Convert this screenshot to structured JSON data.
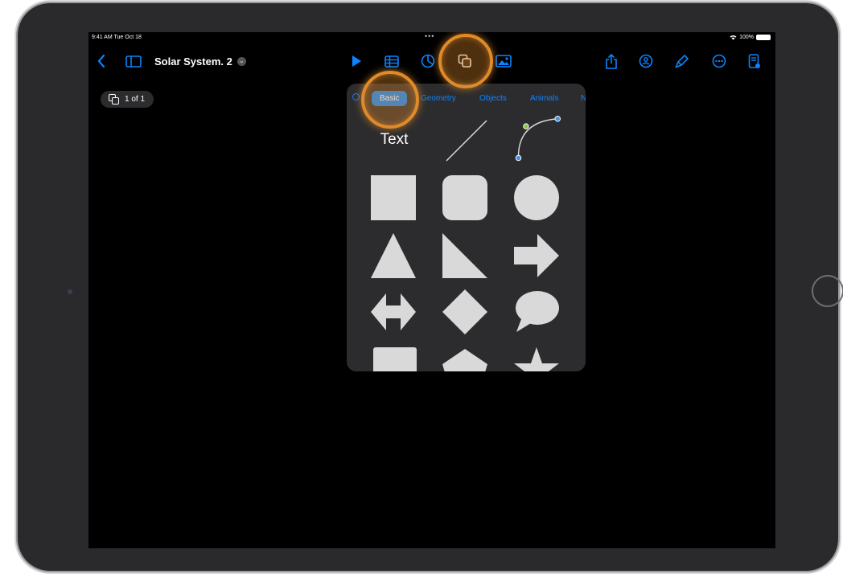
{
  "status_bar": {
    "time": "9:41 AM  Tue Oct 18",
    "dots": "•••",
    "battery": "100%"
  },
  "toolbar": {
    "back_icon": "chevron-left-icon",
    "sidebar_icon": "sidebar-icon",
    "document_title": "Solar System. 2",
    "center_icons": [
      "play-icon",
      "table-icon",
      "chart-icon",
      "shapes-icon",
      "media-icon"
    ],
    "right_icons": [
      "share-icon",
      "collaborate-icon",
      "format-brush-icon",
      "more-icon",
      "document-setup-icon"
    ]
  },
  "page_counter": {
    "label": "1 of 1"
  },
  "shapes_popover": {
    "tabs": [
      {
        "label": "Basic",
        "active": true
      },
      {
        "label": "Geometry",
        "active": false
      },
      {
        "label": "Objects",
        "active": false
      },
      {
        "label": "Animals",
        "active": false
      },
      {
        "label": "N",
        "active": false
      }
    ],
    "text_shape_label": "Text",
    "shapes": [
      "text",
      "line",
      "curve",
      "square",
      "rounded-square",
      "circle",
      "triangle",
      "right-triangle",
      "arrow",
      "double-arrow",
      "diamond",
      "speech-bubble",
      "callout",
      "pentagon",
      "star"
    ]
  },
  "colors": {
    "accent": "#0a84ff",
    "highlight": "#e08a2a",
    "popover_bg": "#2c2c2e",
    "shape_fill": "#d9d9d9"
  }
}
